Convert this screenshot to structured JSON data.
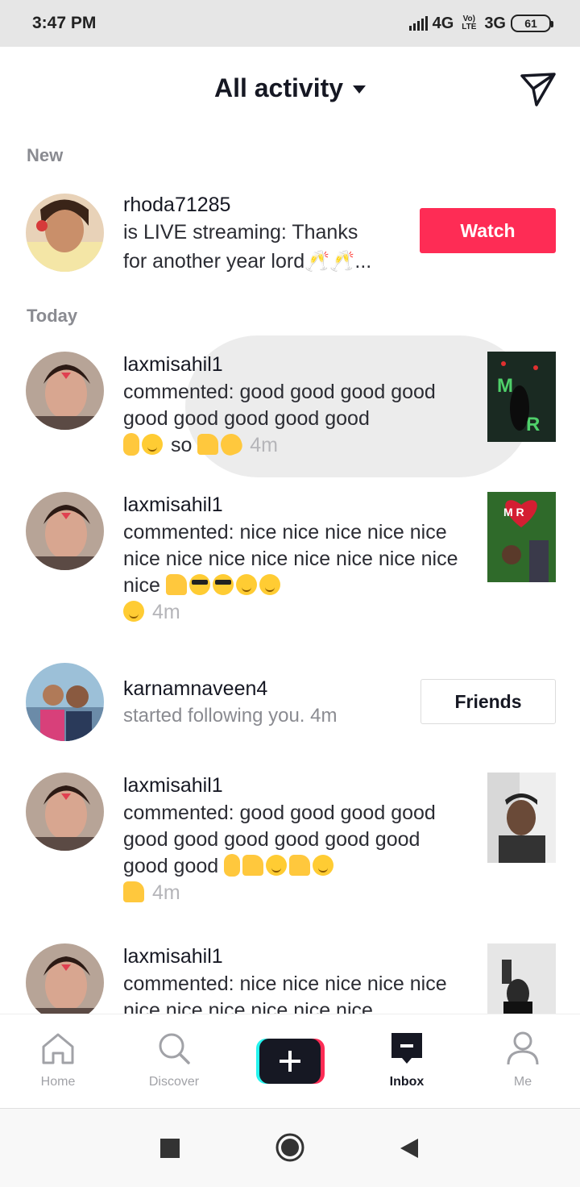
{
  "status_bar": {
    "time": "3:47 PM",
    "network1": "4G",
    "network2": "3G",
    "volte": "Vo) LTE",
    "battery": "61"
  },
  "header": {
    "title": "All activity"
  },
  "sections": {
    "new": "New",
    "today": "Today"
  },
  "live": {
    "username": "rhoda71285",
    "line1": "is LIVE streaming: Thanks",
    "line2": "for another year lord🥂🥂...",
    "button": "Watch"
  },
  "activities": [
    {
      "username": "laxmisahil1",
      "text": "commented: good good good good good good good good good",
      "tail": "so",
      "time": "4m"
    },
    {
      "username": "laxmisahil1",
      "text": "commented: nice nice nice nice nice nice nice nice nice nice nice nice nice nice",
      "time": "4m"
    },
    {
      "username": "karnamnaveen4",
      "text": "started following you.",
      "time": "4m",
      "button": "Friends"
    },
    {
      "username": "laxmisahil1",
      "text": "commented: good good good good good good good good good good good good",
      "time": "4m"
    },
    {
      "username": "laxmisahil1",
      "text": "commented: nice nice nice nice nice nice nice nice nice nice nice"
    }
  ],
  "nav": {
    "home": "Home",
    "discover": "Discover",
    "inbox": "Inbox",
    "me": "Me"
  },
  "colors": {
    "accent": "#fe2c55",
    "cyan": "#25f4ee"
  }
}
